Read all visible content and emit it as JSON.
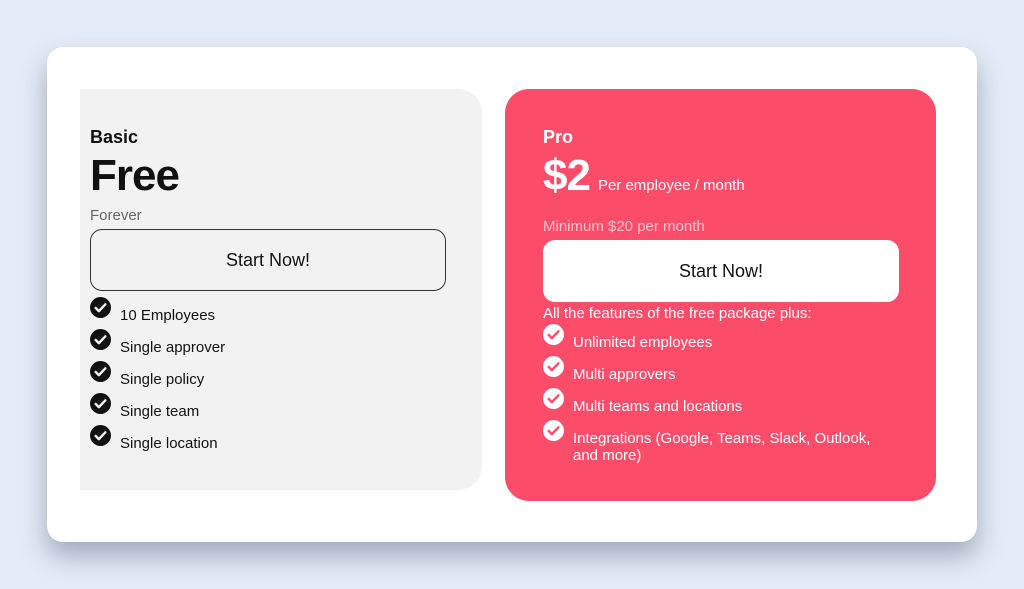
{
  "plans": {
    "basic": {
      "name": "Basic",
      "price": "Free",
      "subtitle": "Forever",
      "button_label": "Start Now!",
      "features": [
        "10 Employees",
        "Single approver",
        "Single policy",
        "Single team",
        "Single location"
      ]
    },
    "pro": {
      "name": "Pro",
      "price": "$2",
      "price_unit": "Per employee / month",
      "subtitle": "Minimum $20 per month",
      "button_label": "Start Now!",
      "features_intro": "All the features of the free package plus:",
      "features": [
        "Unlimited employees",
        "Multi approvers",
        "Multi teams and locations",
        "Integrations (Google, Teams, Slack, Outlook, and more)"
      ]
    }
  },
  "colors": {
    "background": "#e3ecf8",
    "pro_accent": "#fb4d6a",
    "basic_card": "#f2f2f2"
  },
  "icons": {
    "feature_check": "check-circle-icon"
  }
}
